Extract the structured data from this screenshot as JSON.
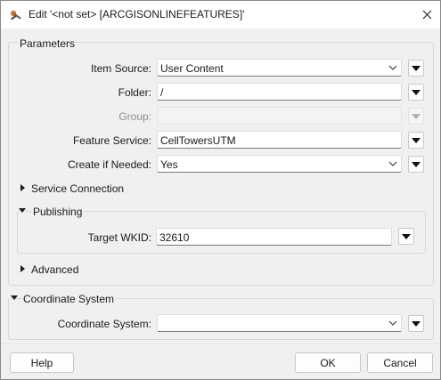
{
  "window": {
    "title": "Edit '<not set> [ARCGISONLINEFEATURES]'",
    "icon": "fme-transformer-icon",
    "close_icon": "close-icon"
  },
  "parameters": {
    "title": "Parameters",
    "item_source": {
      "label": "Item Source:",
      "value": "User Content"
    },
    "folder": {
      "label": "Folder:",
      "value": "/"
    },
    "group": {
      "label": "Group:",
      "value": "",
      "disabled": true
    },
    "feature_service": {
      "label": "Feature Service:",
      "value": "CellTowersUTM"
    },
    "create_if_needed": {
      "label": "Create if Needed:",
      "value": "Yes"
    },
    "service_connection": {
      "label": "Service Connection",
      "expanded": false
    },
    "publishing": {
      "label": "Publishing",
      "expanded": true,
      "target_wkid": {
        "label": "Target WKID:",
        "value": "32610"
      }
    },
    "advanced": {
      "label": "Advanced",
      "expanded": false
    }
  },
  "coordinate_system": {
    "title": "Coordinate System",
    "field": {
      "label": "Coordinate System:",
      "value": ""
    }
  },
  "buttons": {
    "help": "Help",
    "ok": "OK",
    "cancel": "Cancel"
  }
}
